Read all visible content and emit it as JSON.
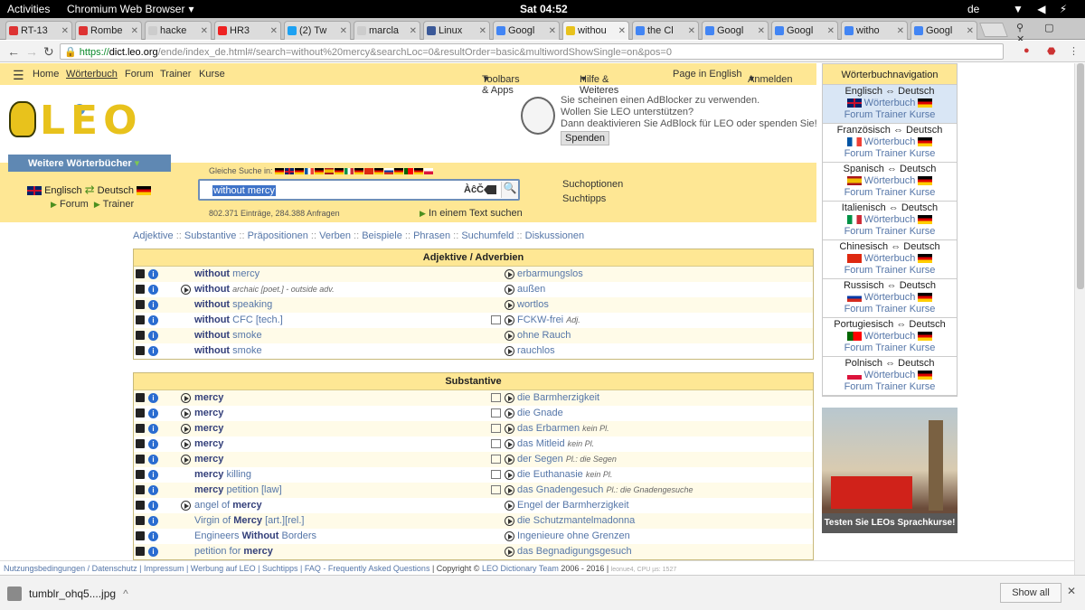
{
  "system": {
    "activities": "Activities",
    "app_name": "Chromium Web Browser",
    "clock": "Sat 04:52",
    "input_lang": "de",
    "tray": "▼ ◀ ⚡ ▾"
  },
  "tabs": [
    {
      "title": "RT-13",
      "color": "#d33"
    },
    {
      "title": "Rombe",
      "color": "#d33"
    },
    {
      "title": "hacke",
      "color": "#ccc"
    },
    {
      "title": "HR3",
      "color": "#e22"
    },
    {
      "title": "(2) Tw",
      "color": "#1da1f2"
    },
    {
      "title": "marcla",
      "color": "#ccc"
    },
    {
      "title": "Linux",
      "color": "#3b5998"
    },
    {
      "title": "Googl",
      "color": "#4285f4"
    },
    {
      "title": "withou",
      "color": "#e8c21c"
    },
    {
      "title": "the Cl",
      "color": "#4285f4"
    },
    {
      "title": "Googl",
      "color": "#4285f4"
    },
    {
      "title": "Googl",
      "color": "#4285f4"
    },
    {
      "title": "witho",
      "color": "#4285f4"
    },
    {
      "title": "Googl",
      "color": "#4285f4"
    }
  ],
  "address": {
    "secure": "https://",
    "domain": "dict.leo.org",
    "path": "/ende/index_de.html#/search=without%20mercy&searchLoc=0&resultOrder=basic&multiwordShowSingle=on&pos=0"
  },
  "leo_nav": {
    "home": "Home",
    "woerterbuch": "Wörterbuch",
    "forum": "Forum",
    "trainer": "Trainer",
    "kurse": "Kurse",
    "toolbars": "Toolbars & Apps",
    "hilfe": "Hilfe & Weiteres",
    "english": "Page in English",
    "anmelden": "Anmelden"
  },
  "logo_text": "LEO",
  "adblock": {
    "line1": "Sie scheinen einen AdBlocker zu verwenden.",
    "line2": "Wollen Sie LEO unterstützen?",
    "line3": "Dann deaktivieren Sie AdBlock für LEO oder spenden Sie!",
    "button": "Spenden"
  },
  "search": {
    "weitere": "Weitere Wörterbücher",
    "lang_from": "Englisch",
    "lang_to": "Deutsch",
    "forum": "Forum",
    "trainer": "Trainer",
    "gleiche": "Gleiche Suche in:",
    "query": "without mercy",
    "abc": "ÀĉČ",
    "stats": "802.371 Einträge, 284.388 Anfragen",
    "intext": "In einem Text suchen",
    "suchoptionen": "Suchoptionen",
    "suchtipps": "Suchtipps"
  },
  "categories": [
    "Adjektive",
    "Substantive",
    "Präpositionen",
    "Verben",
    "Beispiele",
    "Phrasen",
    "Suchumfeld",
    "Diskussionen"
  ],
  "adj_section": {
    "title": "Adjektive / Adverbien",
    "rows": [
      {
        "en_b": "without",
        "en_rest": " mercy",
        "en_b2": "",
        "en_tag": "",
        "de": "erbarmungslos",
        "de_tag": "",
        "play": false,
        "book": false
      },
      {
        "en_b": "without",
        "en_rest": "",
        "en_b2": "",
        "en_tag": "archaic [poet.]   - outside  adv.",
        "de": "außen",
        "de_tag": "",
        "play": true,
        "book": false
      },
      {
        "en_b": "without",
        "en_rest": " speaking",
        "en_b2": "",
        "en_tag": "",
        "de": "wortlos",
        "de_tag": "",
        "play": false,
        "book": false
      },
      {
        "en_b": "without",
        "en_rest": " CFC [tech.]",
        "en_b2": "",
        "en_tag": "",
        "de": "FCKW-frei",
        "de_tag": "Adj.",
        "play": false,
        "book": true
      },
      {
        "en_b": "without",
        "en_rest": " smoke",
        "en_b2": "",
        "en_tag": "",
        "de": "ohne Rauch",
        "de_tag": "",
        "play": false,
        "book": false
      },
      {
        "en_b": "without",
        "en_rest": " smoke",
        "en_b2": "",
        "en_tag": "",
        "de": "rauchlos",
        "de_tag": "",
        "play": false,
        "book": false
      }
    ]
  },
  "subst_section": {
    "title": "Substantive",
    "rows": [
      {
        "en_pre": "",
        "en_b": "mercy",
        "en_rest": "",
        "de": "die Barmherzigkeit",
        "de_tag": "",
        "play": true,
        "book": true
      },
      {
        "en_pre": "",
        "en_b": "mercy",
        "en_rest": "",
        "de": "die Gnade",
        "de_tag": "",
        "play": true,
        "book": true
      },
      {
        "en_pre": "",
        "en_b": "mercy",
        "en_rest": "",
        "de": "das Erbarmen",
        "de_tag": "kein Pl.",
        "play": true,
        "book": true
      },
      {
        "en_pre": "",
        "en_b": "mercy",
        "en_rest": "",
        "de": "das Mitleid",
        "de_tag": "kein Pl.",
        "play": true,
        "book": true
      },
      {
        "en_pre": "",
        "en_b": "mercy",
        "en_rest": "",
        "de": "der Segen",
        "de_tag": "Pl.: die Segen",
        "play": true,
        "book": true
      },
      {
        "en_pre": "",
        "en_b": "mercy",
        "en_rest": " killing",
        "de": "die Euthanasie",
        "de_tag": "kein Pl.",
        "play": false,
        "book": true
      },
      {
        "en_pre": "",
        "en_b": "mercy",
        "en_rest": " petition [law]",
        "de": "das Gnadengesuch",
        "de_tag": "Pl.: die Gnadengesuche",
        "play": false,
        "book": true
      },
      {
        "en_pre": "angel of ",
        "en_b": "mercy",
        "en_rest": "",
        "de": "Engel der Barmherzigkeit",
        "de_tag": "",
        "play": true,
        "book": false
      },
      {
        "en_pre": "Virgin of ",
        "en_b": "Mercy",
        "en_rest": " [art.][rel.]",
        "de": "die Schutzmantelmadonna",
        "de_tag": "",
        "play": false,
        "book": false
      },
      {
        "en_pre": "Engineers ",
        "en_b": "Without",
        "en_rest": " Borders",
        "de": "Ingenieure ohne Grenzen",
        "de_tag": "",
        "play": false,
        "book": false
      },
      {
        "en_pre": "petition for ",
        "en_b": "mercy",
        "en_rest": "",
        "de": "das Begnadigungsgesuch",
        "de_tag": "",
        "play": false,
        "book": false
      }
    ]
  },
  "sidebar": {
    "title": "Wörterbuchnavigation",
    "langs": [
      {
        "name": "Englisch ⇔ Deutsch",
        "flag": "flag-uk",
        "selected": true
      },
      {
        "name": "Französisch ⇔ Deutsch",
        "flag": "flag-fr",
        "selected": false
      },
      {
        "name": "Spanisch ⇔ Deutsch",
        "flag": "flag-es",
        "selected": false
      },
      {
        "name": "Italienisch ⇔ Deutsch",
        "flag": "flag-it",
        "selected": false
      },
      {
        "name": "Chinesisch ⇔ Deutsch",
        "flag": "flag-cn",
        "selected": false
      },
      {
        "name": "Russisch ⇔ Deutsch",
        "flag": "flag-ru",
        "selected": false
      },
      {
        "name": "Portugiesisch ⇔ Deutsch",
        "flag": "flag-pt",
        "selected": false
      },
      {
        "name": "Polnisch ⇔ Deutsch",
        "flag": "flag-pl",
        "selected": false
      }
    ],
    "wb": "Wörterbuch",
    "ft": "Forum Trainer Kurse",
    "promo": "Testen Sie LEOs Sprachkurse!"
  },
  "footer": {
    "links": "Nutzungsbedingungen / Datenschutz | Impressum | Werbung auf LEO | Suchtipps | ",
    "faq": "FAQ - Frequently Asked Questions",
    "copy": " | Copyright © ",
    "team": "LEO Dictionary Team",
    "years": " 2006 - 2016 | ",
    "cpu": "leonue4, CPU µs: 1527"
  },
  "downloads": {
    "file": "tumblr_ohq5....jpg",
    "show_all": "Show all"
  },
  "colors": {
    "leo_yellow": "#fee794",
    "link_blue": "#5576a8",
    "weitere_blue": "#5f88b3"
  }
}
